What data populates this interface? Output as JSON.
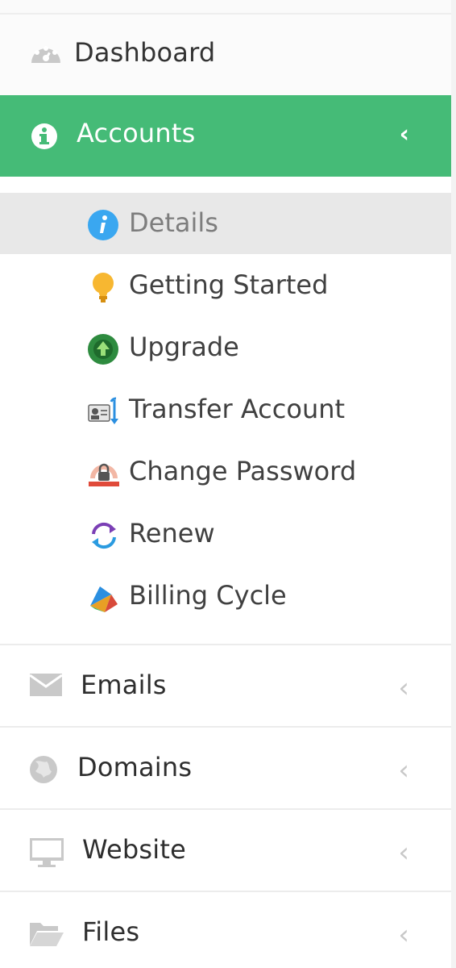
{
  "sidebar": {
    "dashboard": {
      "label": "Dashboard",
      "icon": "dashboard-icon"
    },
    "accounts": {
      "label": "Accounts",
      "icon": "info-circle-icon",
      "chevron": "‹",
      "active_color": "#45bb77",
      "submenu": [
        {
          "label": "Details",
          "icon": "details-info-icon",
          "active": true
        },
        {
          "label": "Getting Started",
          "icon": "lightbulb-icon"
        },
        {
          "label": "Upgrade",
          "icon": "upgrade-icon"
        },
        {
          "label": "Transfer Account",
          "icon": "transfer-account-icon"
        },
        {
          "label": "Change Password",
          "icon": "change-password-icon"
        },
        {
          "label": "Renew",
          "icon": "renew-icon"
        },
        {
          "label": "Billing Cycle",
          "icon": "billing-cycle-icon"
        }
      ]
    },
    "emails": {
      "label": "Emails",
      "icon": "envelope-icon",
      "chevron": "‹"
    },
    "domains": {
      "label": "Domains",
      "icon": "globe-icon",
      "chevron": "‹"
    },
    "website": {
      "label": "Website",
      "icon": "monitor-icon",
      "chevron": "‹"
    },
    "files": {
      "label": "Files",
      "icon": "folder-open-icon",
      "chevron": "‹"
    }
  }
}
